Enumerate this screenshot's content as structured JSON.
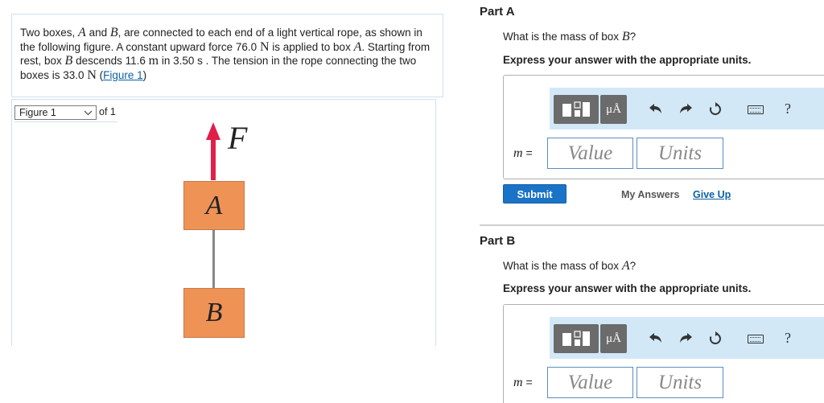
{
  "problem": {
    "text_1": "Two boxes, ",
    "var_a": "A",
    "text_2": " and ",
    "var_b": "B",
    "text_3": ", are connected to each end of a light vertical rope, as shown in the following figure. A constant upward force 76.0 ",
    "unit_n1": "N",
    "text_4": " is applied to box ",
    "var_a2": "A",
    "text_5": ". Starting from rest, box ",
    "var_b2": "B",
    "text_6": " descends 11.6 ",
    "unit_m": "m",
    "text_7": " in 3.50 s . The tension in the rope connecting the two boxes is 33.0 ",
    "unit_n2": "N",
    "text_8": " (",
    "figure_link": "Figure 1",
    "text_9": ")"
  },
  "figure": {
    "selector_value": "Figure 1",
    "of_label": "of 1",
    "force_label": "F",
    "box_top_label": "A",
    "box_bottom_label": "B",
    "box_color": "#ee9256",
    "arrow_color": "#e0204a"
  },
  "part_a": {
    "title": "Part A",
    "question_prefix": "What is the mass of box ",
    "question_var": "B",
    "question_suffix": "?",
    "instructions": "Express your answer with the appropriate units.",
    "m_label_var": "m",
    "m_label_eq": " =",
    "value_placeholder": "Value",
    "units_placeholder": "Units",
    "submit_label": "Submit",
    "my_answers_label": "My Answers",
    "give_up_label": "Give Up"
  },
  "part_b": {
    "title": "Part B",
    "question_prefix": "What is the mass of box ",
    "question_var": "A",
    "question_suffix": "?",
    "instructions": "Express your answer with the appropriate units.",
    "m_label_var": "m",
    "m_label_eq": " =",
    "value_placeholder": "Value",
    "units_placeholder": "Units"
  },
  "toolbar": {
    "units_button_label": "μÅ",
    "help_label": "?",
    "icons": [
      "templates-icon",
      "units-icon",
      "undo-icon",
      "redo-icon",
      "reset-icon",
      "keyboard-icon",
      "help-icon"
    ]
  }
}
